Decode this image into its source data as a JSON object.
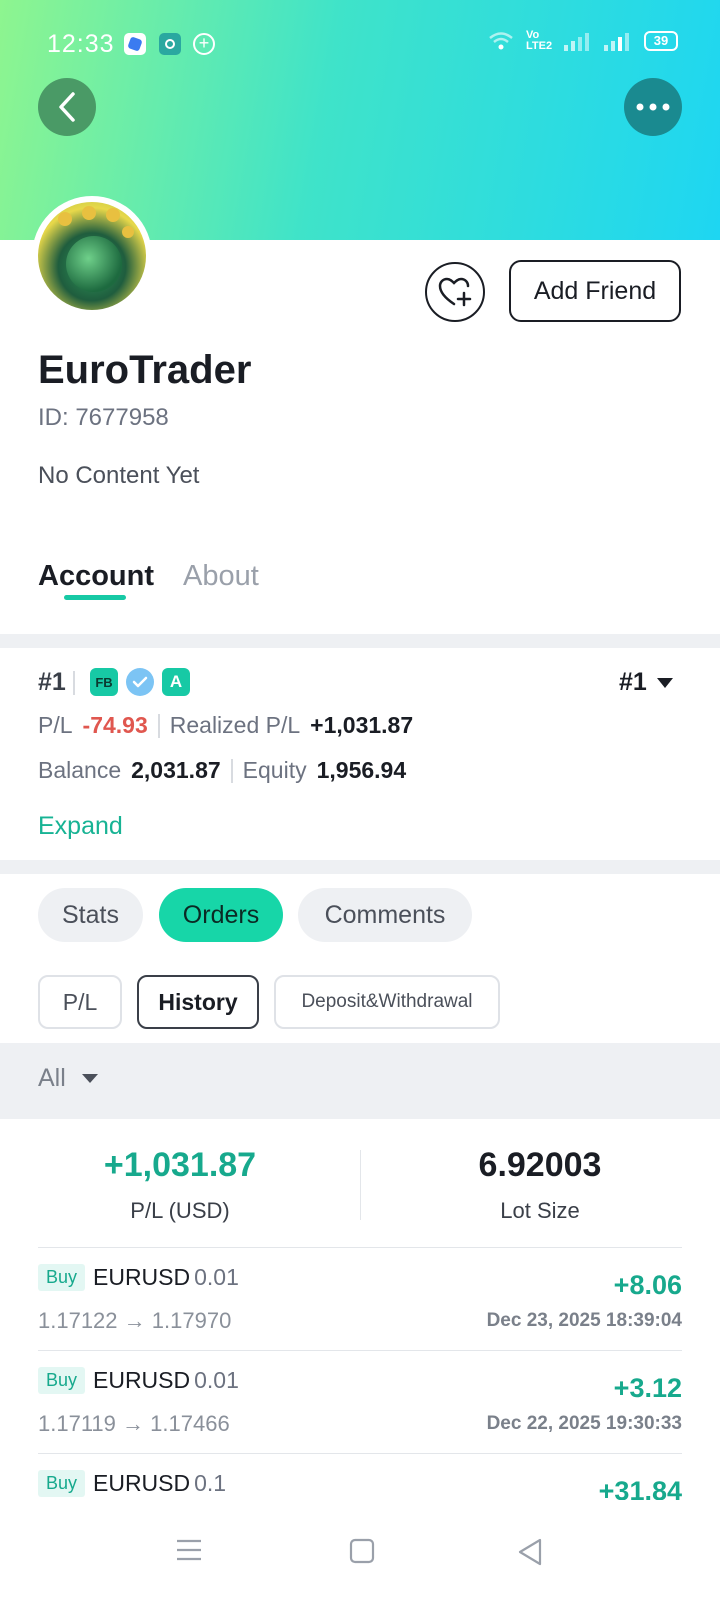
{
  "status_bar": {
    "time": "12:33",
    "battery": "39",
    "network": "Vo LTE2"
  },
  "profile": {
    "name": "EuroTrader",
    "id_text": "ID: 7677958",
    "bio": "No Content Yet",
    "add_friend_label": "Add Friend"
  },
  "tabs": {
    "account": "Account",
    "about": "About"
  },
  "account": {
    "rank": "#1",
    "badges": {
      "fb": "FB",
      "a": "A"
    },
    "selector": "#1",
    "pl_label": "P/L",
    "pl_value": "-74.93",
    "realized_label": "Realized P/L",
    "realized_value": "+1,031.87",
    "balance_label": "Balance",
    "balance_value": "2,031.87",
    "equity_label": "Equity",
    "equity_value": "1,956.94",
    "expand_label": "Expand"
  },
  "section_tabs": [
    "Stats",
    "Orders",
    "Comments"
  ],
  "sub_tabs": [
    "P/L",
    "History",
    "Deposit&Withdrawal"
  ],
  "filter": {
    "label": "All"
  },
  "summary": {
    "pl_value": "+1,031.87",
    "pl_label": "P/L (USD)",
    "lot_value": "6.92003",
    "lot_label": "Lot Size"
  },
  "orders": [
    {
      "side": "Buy",
      "symbol": "EURUSD",
      "lot": "0.01",
      "open": "1.17122",
      "close": "1.17970",
      "pl": "+8.06",
      "date": "Dec 23, 2025 18:39:04"
    },
    {
      "side": "Buy",
      "symbol": "EURUSD",
      "lot": "0.01",
      "open": "1.17119",
      "close": "1.17466",
      "pl": "+3.12",
      "date": "Dec 22, 2025 19:30:33"
    },
    {
      "side": "Buy",
      "symbol": "EURUSD",
      "lot": "0.1",
      "open": "",
      "close": "",
      "pl": "+31.84",
      "date": ""
    }
  ],
  "colors": {
    "accent": "#17c9a5",
    "positive": "#17a98d",
    "negative": "#e0574f"
  }
}
